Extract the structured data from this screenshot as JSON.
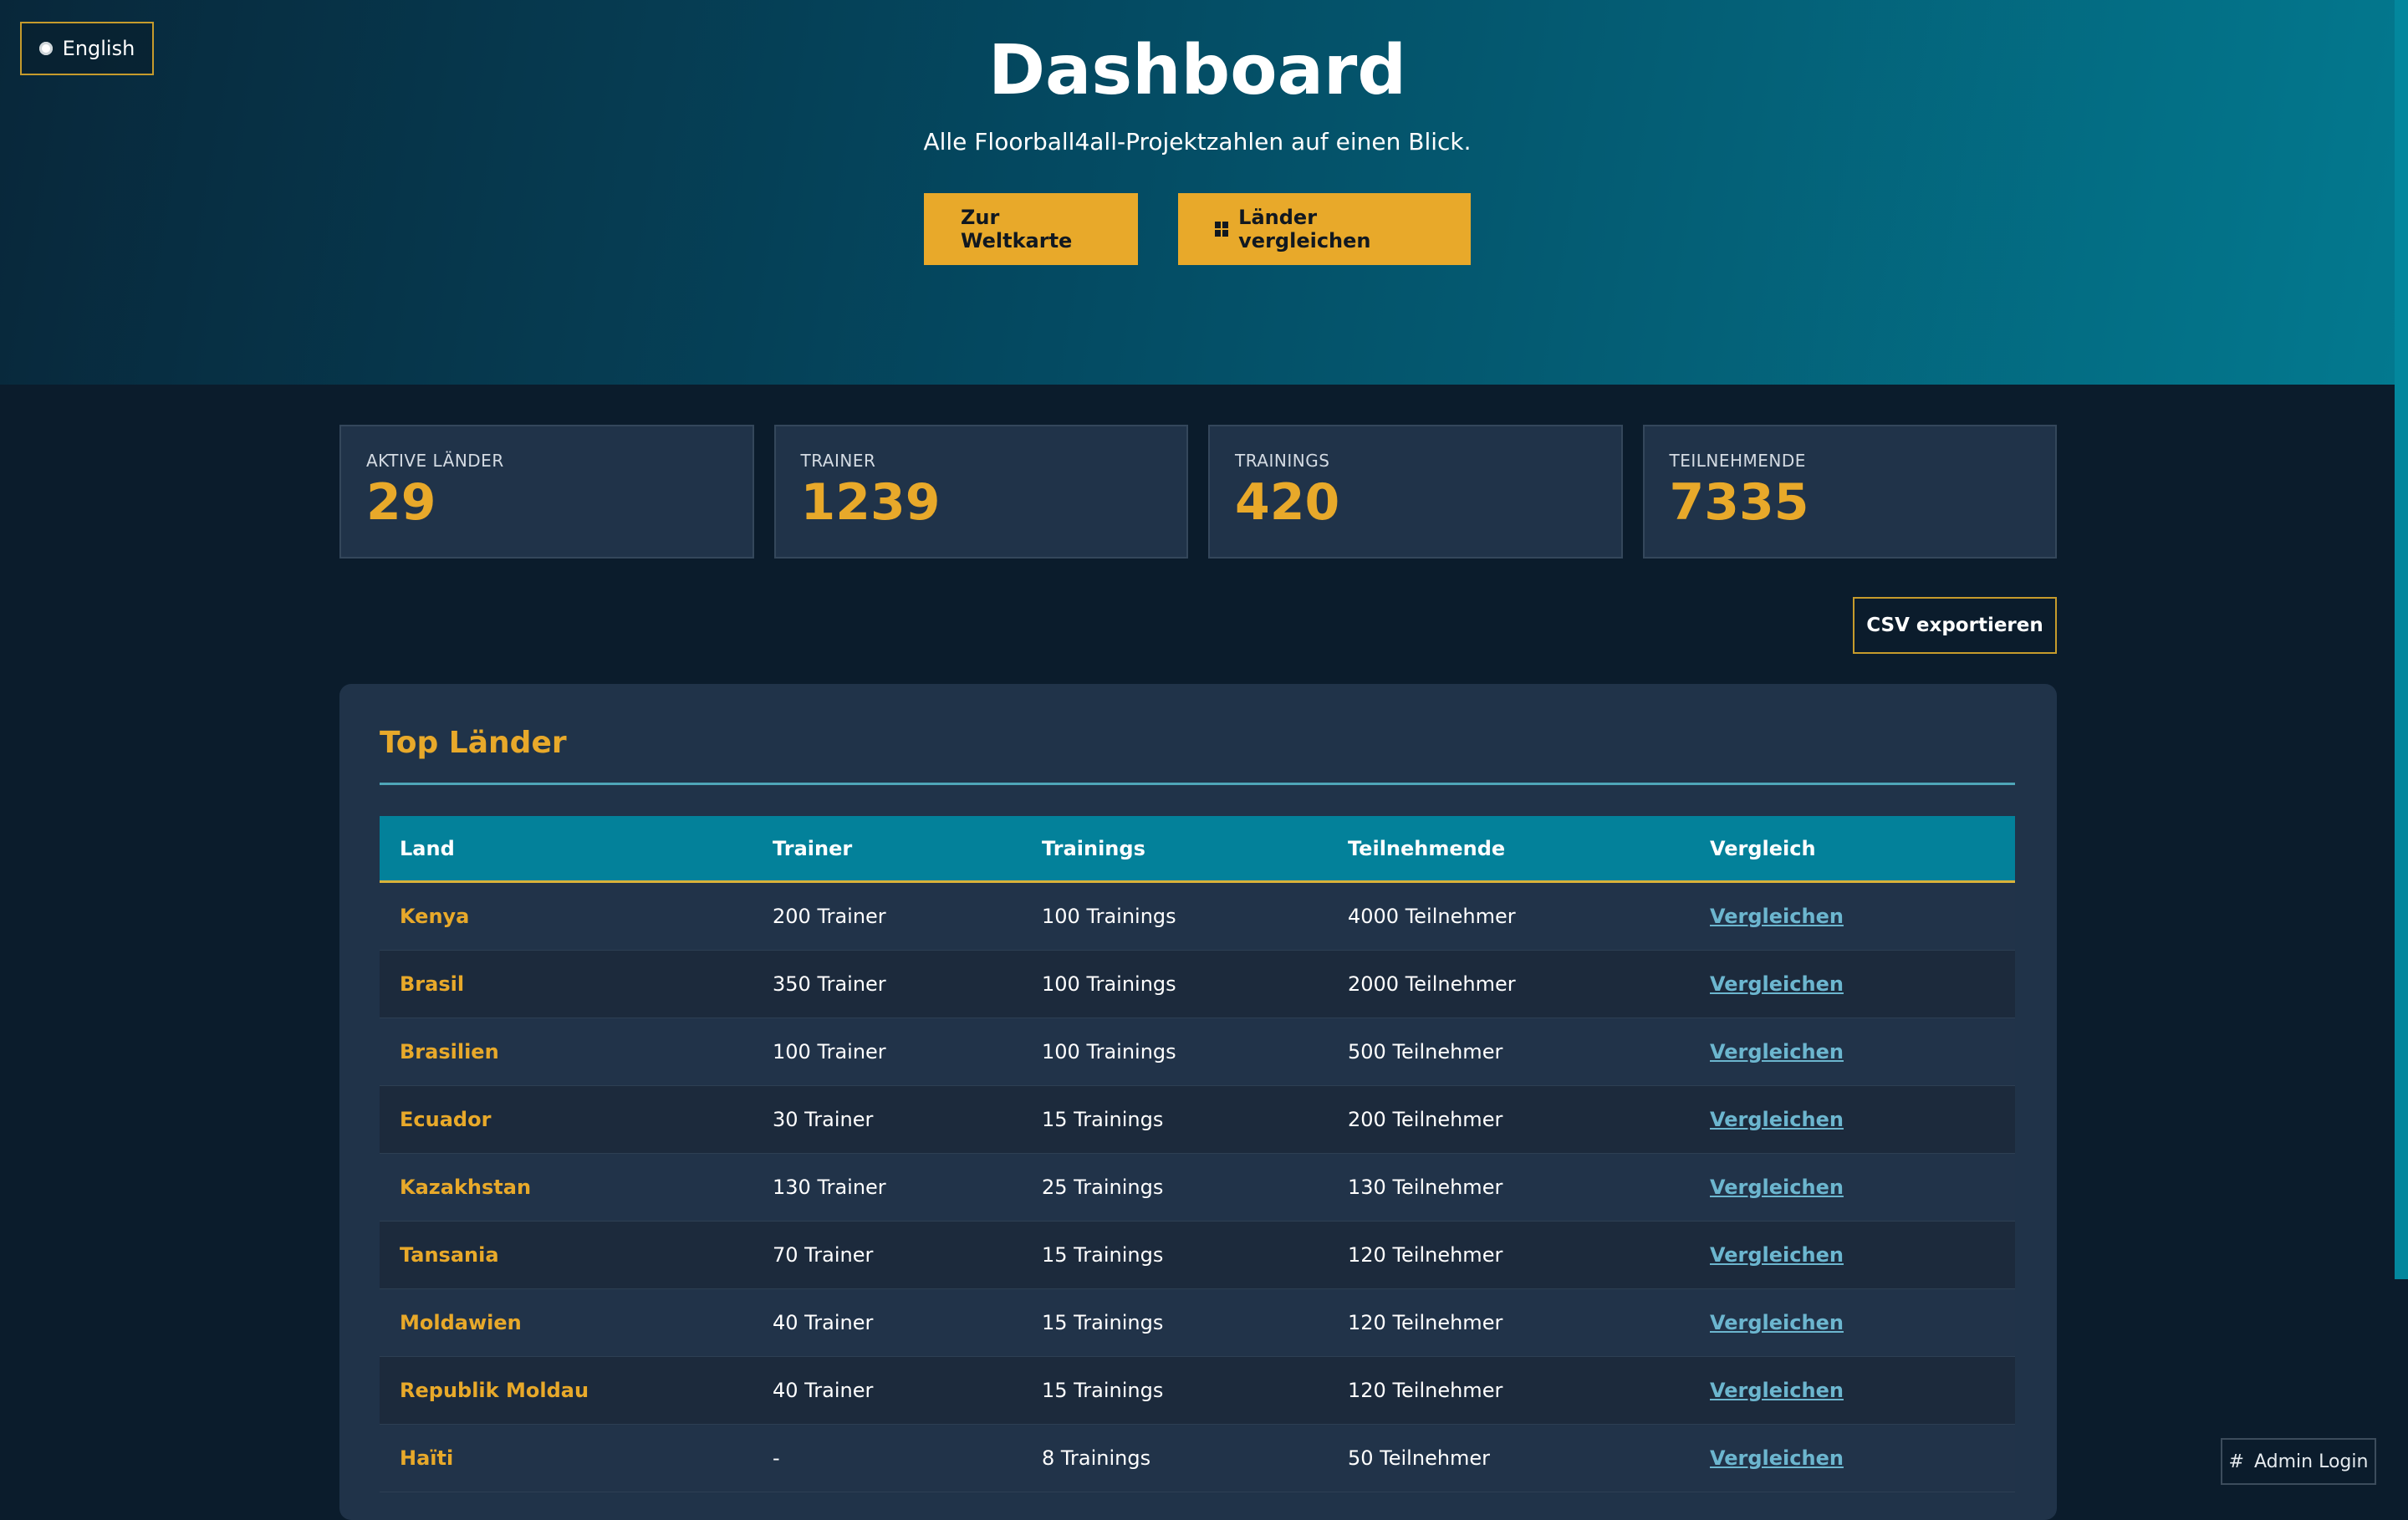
{
  "header": {
    "language_button": "English",
    "title": "Dashboard",
    "subtitle": "Alle Floorball4all-Projektzahlen auf einen Blick.",
    "map_button": "Zur Weltkarte",
    "compare_button": "Länder vergleichen"
  },
  "stats": [
    {
      "label": "AKTIVE LÄNDER",
      "value": "29"
    },
    {
      "label": "TRAINER",
      "value": "1239"
    },
    {
      "label": "TRAININGS",
      "value": "420"
    },
    {
      "label": "TEILNEHMENDE",
      "value": "7335"
    }
  ],
  "csv_button": "CSV exportieren",
  "panel": {
    "title": "Top Länder",
    "columns": [
      "Land",
      "Trainer",
      "Trainings",
      "Teilnehmende",
      "Vergleich"
    ],
    "rows": [
      {
        "land": "Kenya",
        "trainer": "200 Trainer",
        "trainings": "100 Trainings",
        "teilnehmer": "4000 Teilnehmer",
        "link": "Vergleichen"
      },
      {
        "land": "Brasil",
        "trainer": "350 Trainer",
        "trainings": "100 Trainings",
        "teilnehmer": "2000 Teilnehmer",
        "link": "Vergleichen"
      },
      {
        "land": "Brasilien",
        "trainer": "100 Trainer",
        "trainings": "100 Trainings",
        "teilnehmer": "500 Teilnehmer",
        "link": "Vergleichen"
      },
      {
        "land": "Ecuador",
        "trainer": "30 Trainer",
        "trainings": "15 Trainings",
        "teilnehmer": "200 Teilnehmer",
        "link": "Vergleichen"
      },
      {
        "land": "Kazakhstan",
        "trainer": "130 Trainer",
        "trainings": "25 Trainings",
        "teilnehmer": "130 Teilnehmer",
        "link": "Vergleichen"
      },
      {
        "land": "Tansania",
        "trainer": "70 Trainer",
        "trainings": "15 Trainings",
        "teilnehmer": "120 Teilnehmer",
        "link": "Vergleichen"
      },
      {
        "land": "Moldawien",
        "trainer": "40 Trainer",
        "trainings": "15 Trainings",
        "teilnehmer": "120 Teilnehmer",
        "link": "Vergleichen"
      },
      {
        "land": "Republik Moldau",
        "trainer": "40 Trainer",
        "trainings": "15 Trainings",
        "teilnehmer": "120 Teilnehmer",
        "link": "Vergleichen"
      },
      {
        "land": "Haïti",
        "trainer": "-",
        "trainings": "8 Trainings",
        "teilnehmer": "50 Teilnehmer",
        "link": "Vergleichen"
      }
    ]
  },
  "admin_login": "Admin Login",
  "colors": {
    "accent": "#e8a92a",
    "header_teal": "#03819a",
    "link": "#6cb6cf",
    "background": "#0b1c2c",
    "card": "#203349"
  },
  "icons": {
    "language": "globe-dot-icon",
    "compare": "grid-icon",
    "admin": "hash-icon"
  }
}
